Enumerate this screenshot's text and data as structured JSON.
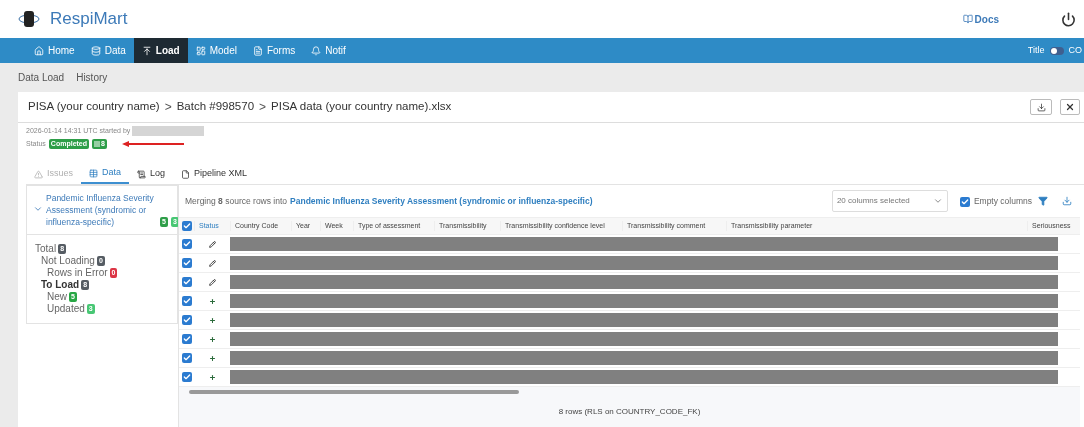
{
  "app": {
    "name": "RespiMart",
    "docs": "Docs"
  },
  "nav": [
    {
      "label": "Home",
      "selected": false
    },
    {
      "label": "Data",
      "selected": false
    },
    {
      "label": "Load",
      "selected": true
    },
    {
      "label": "Model",
      "selected": false
    },
    {
      "label": "Forms",
      "selected": false
    },
    {
      "label": "Notif",
      "selected": false
    }
  ],
  "display_toggle": {
    "label": "Title",
    "on": false,
    "other_label": "CO"
  },
  "subnav": [
    {
      "label": "Data Load"
    },
    {
      "label": "History"
    }
  ],
  "breadcrumb": {
    "items": [
      "PISA (your country name)",
      "Batch #998570",
      "PISA data (your country name).xlsx"
    ],
    "separator": ">"
  },
  "meta": {
    "started": "2026-01-14 14:31 UTC started by",
    "status_label": "Status",
    "status": "Completed",
    "count": "8"
  },
  "tabs": [
    {
      "label": "Issues",
      "selected": false,
      "disabled": true
    },
    {
      "label": "Data",
      "selected": true,
      "disabled": false
    },
    {
      "label": "Log",
      "selected": false,
      "disabled": false
    },
    {
      "label": "Pipeline XML",
      "selected": false,
      "disabled": false
    }
  ],
  "sidebar": {
    "dataset": "Pandemic Influenza Severity Assessment (syndromic or influenza-specific)",
    "expanded": true,
    "new_count": "5",
    "updated_count": "3",
    "stats": [
      {
        "label": "Total",
        "count": "8",
        "color": "#555c63",
        "bold": false,
        "children": [
          {
            "label": "Not Loading",
            "count": "0",
            "color": "#555c63",
            "bold": false,
            "children": [
              {
                "label": "Rows in Error",
                "count": "0",
                "color": "#dc3545",
                "bold": false
              }
            ]
          },
          {
            "label": "To Load",
            "count": "8",
            "color": "#555c63",
            "bold": true,
            "children": [
              {
                "label": "New",
                "count": "5",
                "color": "#28a745",
                "bold": false
              },
              {
                "label": "Updated",
                "count": "3",
                "color": "#48c774",
                "bold": false
              }
            ]
          }
        ]
      }
    ]
  },
  "table": {
    "merge_text": "Merging **8** source rows into",
    "target": "Pandemic Influenza Severity Assessment (syndromic or influenza-specific)",
    "columns_select": "20 columns selected",
    "empty_columns": {
      "label": "Empty columns",
      "checked": true
    },
    "all_checked": true,
    "columns": [
      "Status",
      "Country Code",
      "Year",
      "Week",
      "Type of assessment",
      "Transmissibility",
      "Transmissibility confidence level",
      "Transmissibility comment",
      "Transmissibility parameter",
      "Seriousness"
    ],
    "rows": [
      {
        "checked": true,
        "kind": "updated"
      },
      {
        "checked": true,
        "kind": "updated"
      },
      {
        "checked": true,
        "kind": "updated"
      },
      {
        "checked": true,
        "kind": "new"
      },
      {
        "checked": true,
        "kind": "new"
      },
      {
        "checked": true,
        "kind": "new"
      },
      {
        "checked": true,
        "kind": "new"
      },
      {
        "checked": true,
        "kind": "new"
      }
    ],
    "footer": "8 rows (RLS on COUNTRY_CODE_FK)"
  }
}
